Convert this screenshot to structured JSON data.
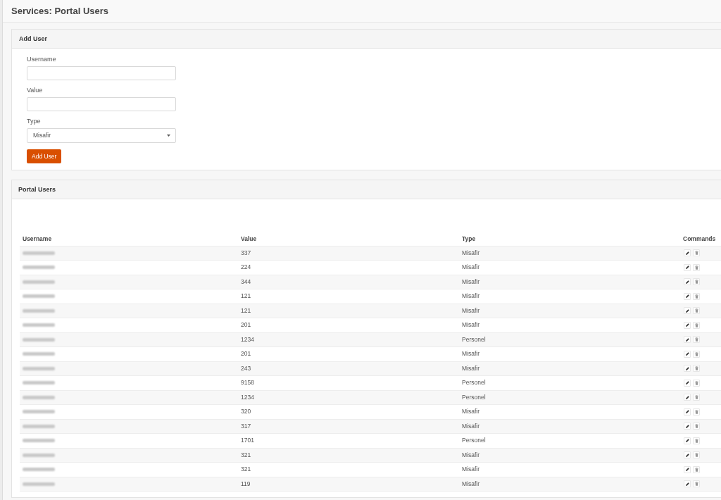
{
  "page_title": "Services: Portal Users",
  "add_user_panel": {
    "title": "Add User",
    "fields": [
      {
        "kind": "text",
        "label": "Username"
      },
      {
        "kind": "text",
        "label": "Value"
      },
      {
        "kind": "select",
        "label": "Type",
        "value": "Misafir"
      }
    ],
    "submit_button": "Add User"
  },
  "portal_users_panel": {
    "title": "Portal Users",
    "table": {
      "columns": [
        "Username",
        "Value",
        "Type",
        "Commands"
      ],
      "rows": [
        {
          "username_blurred": true,
          "value": "337",
          "type": "Misafir"
        },
        {
          "username_blurred": true,
          "value": "224",
          "type": "Misafir"
        },
        {
          "username_blurred": true,
          "value": "344",
          "type": "Misafir"
        },
        {
          "username_blurred": true,
          "value": "121",
          "type": "Misafir"
        },
        {
          "username_blurred": true,
          "value": "121",
          "type": "Misafir"
        },
        {
          "username_blurred": true,
          "value": "201",
          "type": "Misafir"
        },
        {
          "username_blurred": true,
          "value": "1234",
          "type": "Personel"
        },
        {
          "username_blurred": true,
          "value": "201",
          "type": "Misafir"
        },
        {
          "username_blurred": true,
          "value": "243",
          "type": "Misafir"
        },
        {
          "username_blurred": true,
          "value": "9158",
          "type": "Personel"
        },
        {
          "username_blurred": true,
          "value": "1234",
          "type": "Personel"
        },
        {
          "username_blurred": true,
          "value": "320",
          "type": "Misafir"
        },
        {
          "username_blurred": true,
          "value": "317",
          "type": "Misafir"
        },
        {
          "username_blurred": true,
          "value": "1701",
          "type": "Personel"
        },
        {
          "username_blurred": true,
          "value": "321",
          "type": "Misafir"
        },
        {
          "username_blurred": true,
          "value": "321",
          "type": "Misafir"
        },
        {
          "username_blurred": true,
          "value": "119",
          "type": "Misafir"
        }
      ]
    }
  }
}
